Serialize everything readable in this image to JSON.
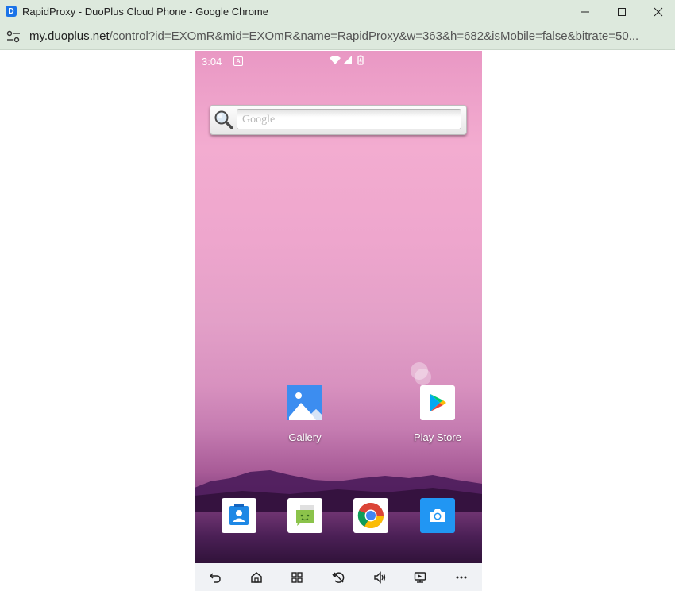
{
  "window": {
    "title": "RapidProxy - DuoPlus Cloud Phone - Google Chrome",
    "app_icon_glyph": "D",
    "minimize_icon": "minimize-icon",
    "maximize_icon": "maximize-icon",
    "close_icon": "close-icon"
  },
  "address_bar": {
    "host": "my.duoplus.net",
    "path": "/control?id=EXOmR&mid=EXOmR&name=RapidProxy&w=363&h=682&isMobile=false&bitrate=50..."
  },
  "phone": {
    "status_bar": {
      "time": "3:04",
      "notification_letter": "A"
    },
    "search_widget": {
      "placeholder": "Google"
    },
    "apps": [
      {
        "label": "Gallery",
        "icon": "gallery-icon"
      },
      {
        "label": "Play Store",
        "icon": "play-store-icon"
      }
    ],
    "dock": [
      {
        "icon": "contacts-icon"
      },
      {
        "icon": "messaging-icon"
      },
      {
        "icon": "chrome-icon"
      },
      {
        "icon": "camera-icon"
      }
    ]
  },
  "toolbar": {
    "buttons": [
      "back-icon",
      "home-icon",
      "recents-icon",
      "rotate-lock-icon",
      "volume-icon",
      "screen-icon",
      "more-icon"
    ]
  },
  "colors": {
    "chrome_frame": "#dde9dd",
    "toolbar_bg": "#f0f2f5",
    "accent_blue": "#1a73e8"
  }
}
